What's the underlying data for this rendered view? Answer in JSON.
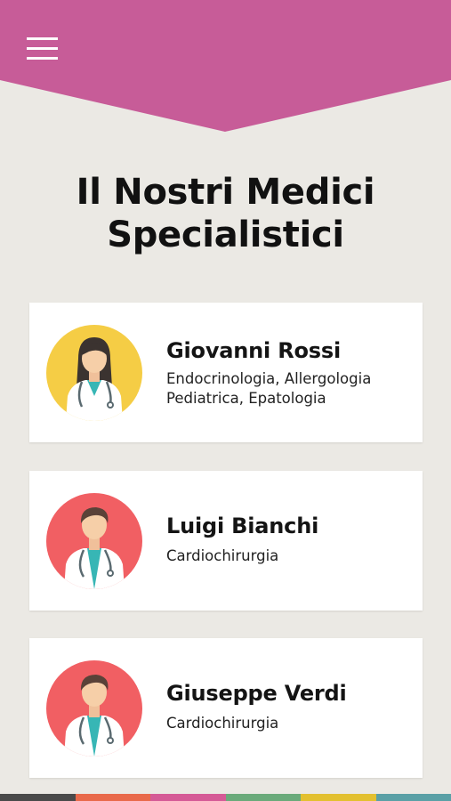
{
  "header": {
    "menu_icon": "hamburger-icon",
    "color": "#c75c98"
  },
  "page_title_lines": [
    "Il Nostri Medici",
    "Specialistici"
  ],
  "doctors": [
    {
      "name": "Giovanni Rossi",
      "specialties": [
        "Endocrinologia, Allergologia",
        "Pediatrica, Epatologia"
      ],
      "avatar": "female-doctor-icon",
      "avatar_bg": "#f5cd45"
    },
    {
      "name": "Luigi Bianchi",
      "specialties": [
        "Cardiochirurgia"
      ],
      "avatar": "male-doctor-icon",
      "avatar_bg": "#f15f63"
    },
    {
      "name": "Giuseppe Verdi",
      "specialties": [
        "Cardiochirurgia"
      ],
      "avatar": "male-doctor-icon",
      "avatar_bg": "#f15f63"
    }
  ],
  "footer_colors": [
    "#4a4a4a",
    "#e9694a",
    "#d55a96",
    "#6aaa7a",
    "#e3c02f",
    "#5aa0a6"
  ]
}
